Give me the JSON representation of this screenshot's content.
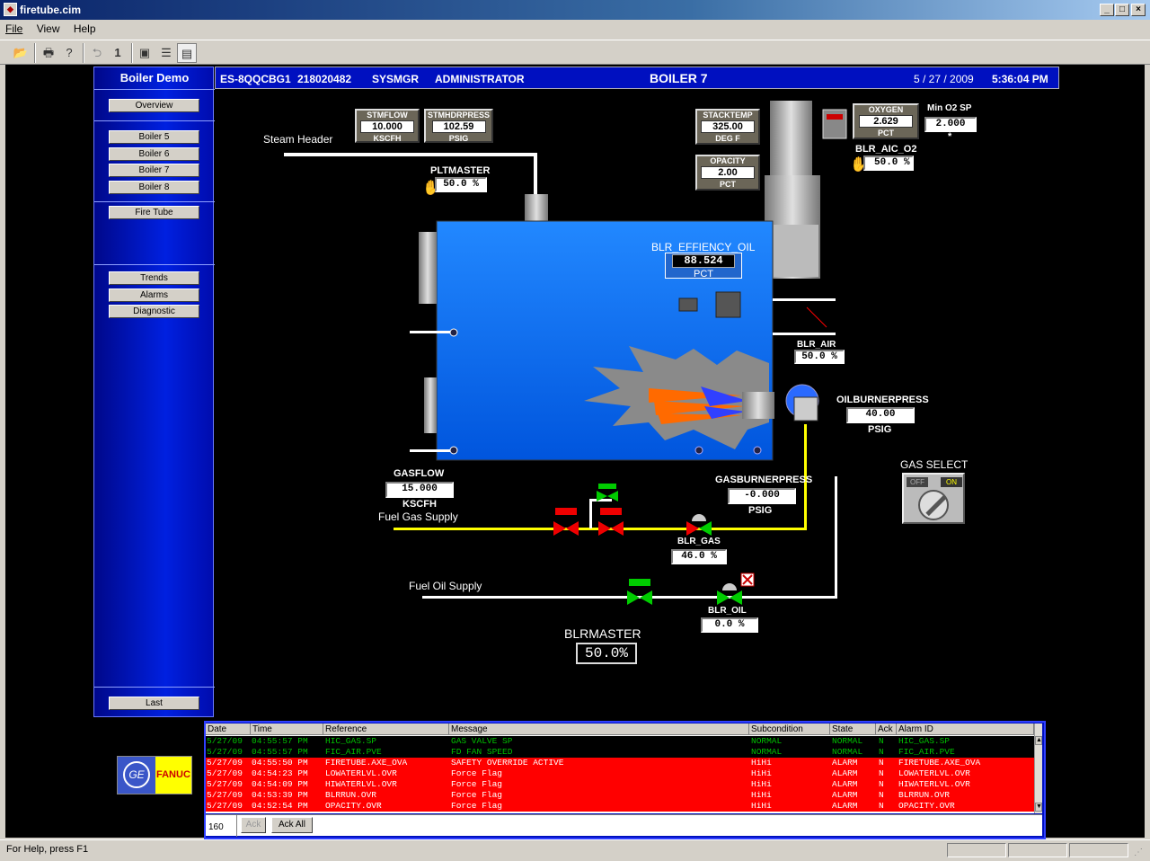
{
  "window": {
    "title": "firetube.cim"
  },
  "menu": [
    "File",
    "View",
    "Help"
  ],
  "toolbar": {
    "page_number": "1"
  },
  "nav": {
    "title": "Boiler Demo",
    "overview": "Overview",
    "boilers": [
      "Boiler 5",
      "Boiler 6",
      "Boiler 7",
      "Boiler 8"
    ],
    "fire_tube": "Fire Tube",
    "trends": "Trends",
    "alarms": "Alarms",
    "diagnostic": "Diagnostic",
    "last": "Last"
  },
  "header": {
    "node": "ES-8QQCBG1",
    "id": "218020482",
    "user": "SYSMGR",
    "role": "ADMINISTRATOR",
    "title": "BOILER 7",
    "date": "5 / 27 / 2009",
    "time": "5:36:04 PM"
  },
  "process": {
    "steam_header": "Steam Header",
    "stmflow": {
      "label": "STMFLOW",
      "value": "10.000",
      "unit": "KSCFH"
    },
    "stmhdrpress": {
      "label": "STMHDRPRESS",
      "value": "102.59",
      "unit": "PSIG"
    },
    "stacktemp": {
      "label": "STACKTEMP",
      "value": "325.00",
      "unit": "DEG F"
    },
    "opacity": {
      "label": "OPACITY",
      "value": "2.00",
      "unit": "PCT"
    },
    "oxygen": {
      "label": "OXYGEN",
      "value": "2.629",
      "unit": "PCT"
    },
    "min_o2_sp": {
      "label": "Min O2 SP",
      "value": "2.000",
      "mark": "*"
    },
    "blr_aic_o2": {
      "label": "BLR_AIC_O2",
      "value": "50.0 %"
    },
    "pltmaster": {
      "label": "PLTMASTER",
      "value": "50.0 %"
    },
    "blr_effiency_oil": {
      "label": "BLR_EFFIENCY_OIL",
      "value": "88.524",
      "unit": "PCT"
    },
    "blr_air": {
      "label": "BLR_AIR",
      "value": "50.0 %"
    },
    "oilburnerpress": {
      "label": "OILBURNERPRESS",
      "value": "40.00",
      "unit": "PSIG"
    },
    "gasflow": {
      "label": "GASFLOW",
      "value": "15.000",
      "unit": "KSCFH"
    },
    "fuel_gas_supply": "Fuel Gas Supply",
    "gasburnerpress": {
      "label": "GASBURNERPRESS",
      "value": "-0.000",
      "unit": "PSIG"
    },
    "blr_gas": {
      "label": "BLR_GAS",
      "value": "46.0 %"
    },
    "fuel_oil_supply": "Fuel Oil Supply",
    "blr_oil": {
      "label": "BLR_OIL",
      "value": "0.0 %"
    },
    "blrmaster": {
      "label": "BLRMASTER",
      "value": "50.0%"
    },
    "gas_select": {
      "label": "GAS SELECT",
      "off": "OFF",
      "on": "ON"
    }
  },
  "alarms": {
    "columns": [
      "Date",
      "Time",
      "Reference",
      "Message",
      "Subcondition",
      "State",
      "Ack",
      "Alarm ID"
    ],
    "rows": [
      {
        "date": "5/27/09",
        "time": "04:55:57 PM",
        "ref": "HIC_GAS.SP",
        "msg": "GAS VALVE SP",
        "sub": "NORMAL",
        "state": "NORMAL",
        "ack": "N",
        "id": "HIC_GAS.SP",
        "kind": "green"
      },
      {
        "date": "5/27/09",
        "time": "04:55:57 PM",
        "ref": "FIC_AIR.PVE",
        "msg": "FD FAN SPEED",
        "sub": "NORMAL",
        "state": "NORMAL",
        "ack": "N",
        "id": "FIC_AIR.PVE",
        "kind": "green"
      },
      {
        "date": "5/27/09",
        "time": "04:55:50 PM",
        "ref": "FIRETUBE.AXE_OVA",
        "msg": "SAFETY OVERRIDE ACTIVE",
        "sub": "HiHi",
        "state": "ALARM",
        "ack": "N",
        "id": "FIRETUBE.AXE_OVA",
        "kind": "red"
      },
      {
        "date": "5/27/09",
        "time": "04:54:23 PM",
        "ref": "LOWATERLVL.OVR",
        "msg": "Force Flag",
        "sub": "HiHi",
        "state": "ALARM",
        "ack": "N",
        "id": "LOWATERLVL.OVR",
        "kind": "red"
      },
      {
        "date": "5/27/09",
        "time": "04:54:09 PM",
        "ref": "HIWATERLVL.OVR",
        "msg": "Force Flag",
        "sub": "HiHi",
        "state": "ALARM",
        "ack": "N",
        "id": "HIWATERLVL.OVR",
        "kind": "red"
      },
      {
        "date": "5/27/09",
        "time": "04:53:39 PM",
        "ref": "BLRRUN.OVR",
        "msg": "Force Flag",
        "sub": "HiHi",
        "state": "ALARM",
        "ack": "N",
        "id": "BLRRUN.OVR",
        "kind": "red"
      },
      {
        "date": "5/27/09",
        "time": "04:52:54 PM",
        "ref": "OPACITY.OVR",
        "msg": "Force Flag",
        "sub": "HiHi",
        "state": "ALARM",
        "ack": "N",
        "id": "OPACITY.OVR",
        "kind": "red"
      }
    ],
    "count": "160",
    "ack": "Ack",
    "ack_all": "Ack All"
  },
  "logo": {
    "text": "FANUC"
  },
  "status": {
    "help": "For Help, press F1"
  }
}
